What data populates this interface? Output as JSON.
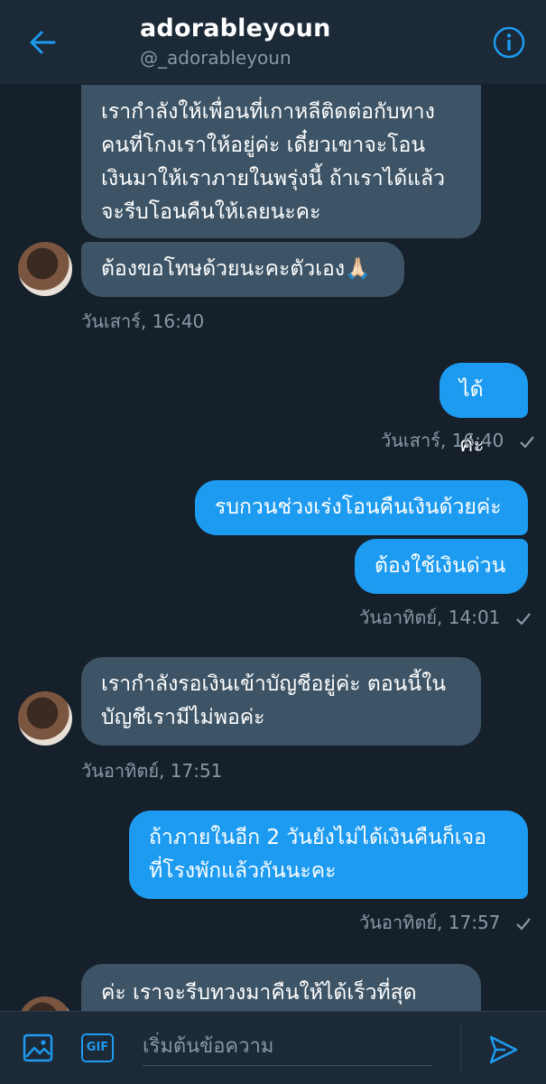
{
  "header": {
    "title": "adorableyoun",
    "handle": "@_adorableyoun"
  },
  "messages": [
    {
      "direction": "in",
      "text": "เรากำลังให้เพื่อนที่เกาหลีติดต่อกับทาง\nคนที่โกงเราให้อยู่ค่ะ เดี๋ยวเขาจะโอน\nเงินมาให้เราภายในพรุ่งนี้ ถ้าเราได้แล้ว\nจะรีบโอนคืนให้เลยนะคะ"
    },
    {
      "direction": "in",
      "text": "ต้องขอโทษด้วยนะคะตัวเอง🙏🏻"
    },
    {
      "direction": "out",
      "text": "ได้ค่ะ"
    },
    {
      "direction": "out",
      "text": "รบกวนช่วงเร่งโอนคืนเงินด้วยค่ะ"
    },
    {
      "direction": "out",
      "text": "ต้องใช้เงินด่วน"
    },
    {
      "direction": "in",
      "text": "เรากำลังรอเงินเข้าบัญชีอยู่ค่ะ ตอนนี้ใน\nบัญชีเรามีไม่พอค่ะ"
    },
    {
      "direction": "out",
      "text": "ถ้าภายในอีก 2 วันยังไม่ได้เงินคืนก็เจอ\nที่โรงพักแล้วกันนะคะ"
    },
    {
      "direction": "in",
      "text": "ค่ะ เราจะรีบทวงมาคืนให้ได้เร็วที่สุด"
    }
  ],
  "timestamps": [
    "วันเสาร์, 16:40",
    "วันเสาร์, 16:40",
    "วันอาทิตย์, 14:01",
    "วันอาทิตย์, 17:51",
    "วันอาทิตย์, 17:57"
  ],
  "composer": {
    "placeholder": "เริ่มต้นข้อความ",
    "gif_label": "GIF"
  },
  "colors": {
    "background": "#15202b",
    "bar": "#1c2937",
    "incoming_bubble": "#3d5466",
    "outgoing_bubble": "#1d9bf0",
    "muted_text": "#8899a6",
    "accent": "#1d9bf0"
  },
  "icons": {
    "back": "back-arrow-icon",
    "info": "info-icon",
    "read_receipt": "checkmark-icon",
    "image": "image-icon",
    "send": "send-icon"
  }
}
